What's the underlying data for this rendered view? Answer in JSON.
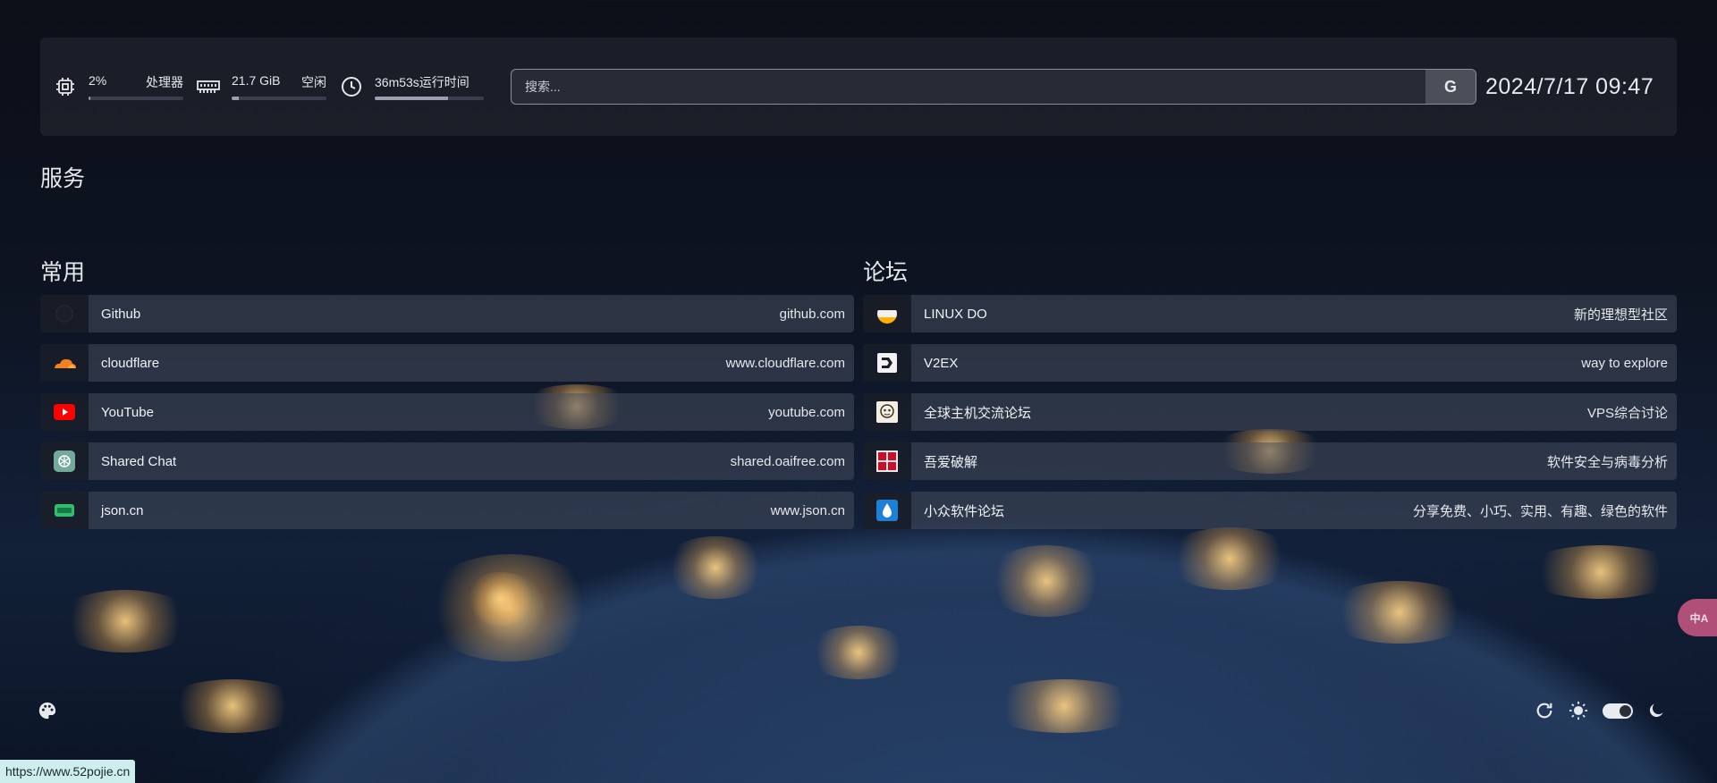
{
  "stats": {
    "cpu": {
      "value": "2%",
      "label": "处理器",
      "progress": 0.02
    },
    "memory": {
      "value": "21.7 GiB",
      "label": "空闲",
      "progress": 0.08
    },
    "uptime": {
      "value": "36m53s运行时间",
      "progress": 0.67
    }
  },
  "search": {
    "placeholder": "搜索...",
    "button_label": "G"
  },
  "datetime": "2024/7/17 09:47",
  "sections": {
    "services": "服务"
  },
  "groups": [
    {
      "title": "常用",
      "items": [
        {
          "name": "Github",
          "sub": "github.com",
          "icon": "github-icon"
        },
        {
          "name": "cloudflare",
          "sub": "www.cloudflare.com",
          "icon": "cloudflare-icon"
        },
        {
          "name": "YouTube",
          "sub": "youtube.com",
          "icon": "youtube-icon"
        },
        {
          "name": "Shared Chat",
          "sub": "shared.oaifree.com",
          "icon": "openai-icon"
        },
        {
          "name": "json.cn",
          "sub": "www.json.cn",
          "icon": "json-icon"
        }
      ]
    },
    {
      "title": "论坛",
      "items": [
        {
          "name": "LINUX DO",
          "sub": "新的理想型社区",
          "icon": "linuxdo-icon"
        },
        {
          "name": "V2EX",
          "sub": "way to explore",
          "icon": "v2ex-icon"
        },
        {
          "name": "全球主机交流论坛",
          "sub": "VPS综合讨论",
          "icon": "hostloc-icon"
        },
        {
          "name": "吾爱破解",
          "sub": "软件安全与病毒分析",
          "icon": "52pojie-icon"
        },
        {
          "name": "小众软件论坛",
          "sub": "分享免费、小巧、实用、有趣、绿色的软件",
          "icon": "appinn-icon"
        }
      ]
    }
  ],
  "translate_label": "中A",
  "status_url": "https://www.52pojie.cn",
  "colors": {
    "youtube": "#ff0000",
    "cloudflare": "#f38020",
    "json": "#2fbf71",
    "appinn": "#1e7fd6",
    "pojie": "#c8102e",
    "translate": "#b04f78"
  }
}
